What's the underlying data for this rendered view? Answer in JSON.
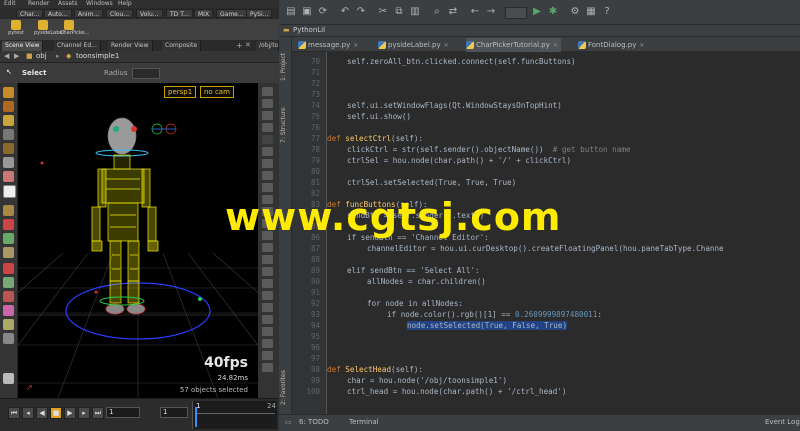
{
  "houdini": {
    "menu": [
      "Edit",
      "Render",
      "Assets",
      "Windows",
      "Help"
    ],
    "shelf_tabs": [
      "Char...",
      "Auto...",
      "Anim...",
      "Clou...",
      "Volu...",
      "TD T...",
      "MIX",
      "Game...",
      "PySi..."
    ],
    "shelf_tools": [
      {
        "label": "pytest",
        "color": "#e0b030"
      },
      {
        "label": "pysideLabel",
        "color": "#e0b030"
      },
      {
        "label": "CharPicke...",
        "color": "#e0b030"
      }
    ],
    "pane_tabs": [
      "Scene View",
      "Channel Ed...",
      "Render View",
      "Composite",
      "/obj/toon..."
    ],
    "path": {
      "network": "obj",
      "node": "toonsimple1"
    },
    "tool_label": "Select",
    "radius_label": "Radius",
    "viewport": {
      "camera": "persp1",
      "cam_menu": "no cam",
      "fps": "40fps",
      "ms": "24.82ms",
      "selected": "57 objects selected"
    },
    "timeline": {
      "frame": "1",
      "start": "1",
      "current": "1",
      "tick_24": "24"
    }
  },
  "pycharm": {
    "project_label": "PythonLil",
    "side_labels": {
      "project": "1: Project",
      "structure": "7: Structure",
      "favorites": "2: Favorites"
    },
    "tabs": [
      {
        "name": "message.py",
        "active": false
      },
      {
        "name": "pysideLabel.py",
        "active": false
      },
      {
        "name": "CharPickerTutorial.py",
        "active": true
      },
      {
        "name": "FontDialog.py",
        "active": false
      }
    ],
    "status": {
      "todo": "6: TODO",
      "terminal": "Terminal",
      "event_log": "Event Log"
    },
    "line_numbers": [
      "70",
      "71",
      "72",
      "73",
      "74",
      "75",
      "76",
      "77",
      "78",
      "79",
      "80",
      "81",
      "82",
      "83",
      "84",
      "85",
      "86",
      "87",
      "88",
      "89",
      "90",
      "91",
      "92",
      "93",
      "94",
      "95",
      "96",
      "97",
      "98",
      "99",
      "100"
    ],
    "code": {
      "l70": "self.zeroAll_btn.clicked.connect(self.funcButtons)",
      "l74": "self.ui.setWindowFlags(Qt.WindowStaysOnTopHint)",
      "l75": "self.ui.show()",
      "l77_def": "def ",
      "l77_name": "selectCtrl",
      "l77_rest": "(self):",
      "l78": "clickCtrl = str(self.sender().objectName())",
      "l78_cm": "# get button name",
      "l79": "ctrlSel = hou.node(char.path() + '/' + clickCtrl)",
      "l81": "ctrlSel.setSelected(True, True, True)",
      "l83_def": "def ",
      "l83_name": "funcButtons",
      "l83_rest": "(self):",
      "l84": "sendBtn = self.sender().text()",
      "l86": "if sendBtn == 'Channel Editor':",
      "l87": "channelEditor = hou.ui.curDesktop().createFloatingPanel(hou.paneTabType.Channe",
      "l89": "elif sendBtn == 'Select All':",
      "l90": "allNodes = char.children()",
      "l92": "for node in allNodes:",
      "l93_pre": "if node.color().rgb()[1] == ",
      "l93_num": "0.2609999897480011",
      "l93_post": ":",
      "l94": "node.setSelected(True, False, True)",
      "l98_def": "def ",
      "l98_name": "SelectHead",
      "l98_rest": "(self):",
      "l99": "char = hou.node('/obj/toonsimple1')",
      "l100": "ctrl_head = hou.node(char.path() + '/ctrl_head')"
    }
  },
  "watermark": "www.cgtsj.com",
  "colors": {
    "wireframe": "#f5f000",
    "selection": "#214283",
    "keyword": "#cc7832",
    "houdini_bg": "#3a3a3a",
    "editor_bg": "#2b2b2b"
  }
}
